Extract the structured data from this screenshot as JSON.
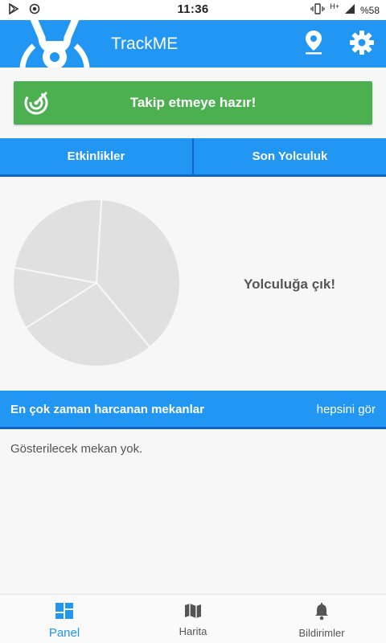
{
  "status_bar": {
    "time": "11:36",
    "battery": "%58",
    "network": "H+",
    "icons": [
      "play-store-icon",
      "record-icon",
      "vibrate-icon",
      "signal-icon",
      "battery-icon"
    ]
  },
  "app_bar": {
    "title": "TrackME",
    "icons": [
      "app-logo-icon",
      "location-pin-icon",
      "gear-icon"
    ]
  },
  "status_button": {
    "label": "Takip etmeye hazır!",
    "icon": "radar-icon",
    "color": "#4caf50"
  },
  "tabs": [
    {
      "label": "Etkinlikler"
    },
    {
      "label": "Son Yolculuk"
    }
  ],
  "chart_data": {
    "type": "pie",
    "title": "",
    "slices": [
      {
        "label": "",
        "value": 38
      },
      {
        "label": "",
        "value": 27
      },
      {
        "label": "",
        "value": 12
      },
      {
        "label": "",
        "value": 23
      }
    ],
    "colors": [
      "#e0e0e0"
    ],
    "legend": "none"
  },
  "chart_placeholder": "Yolculuğa çık!",
  "places_section": {
    "title": "En çok zaman harcanan mekanlar",
    "see_all": "hepsini gör",
    "empty_text": "Gösterilecek mekan yok."
  },
  "bottom_nav": {
    "items": [
      {
        "label": "Panel",
        "icon": "dashboard-icon",
        "active": true
      },
      {
        "label": "Harita",
        "icon": "map-icon",
        "active": false
      },
      {
        "label": "Bildirimler",
        "icon": "bell-icon",
        "active": false
      }
    ]
  },
  "colors": {
    "primary": "#2196f3",
    "primary_dark": "#1565c0",
    "success": "#4caf50",
    "pie": "#e0e0e0"
  }
}
